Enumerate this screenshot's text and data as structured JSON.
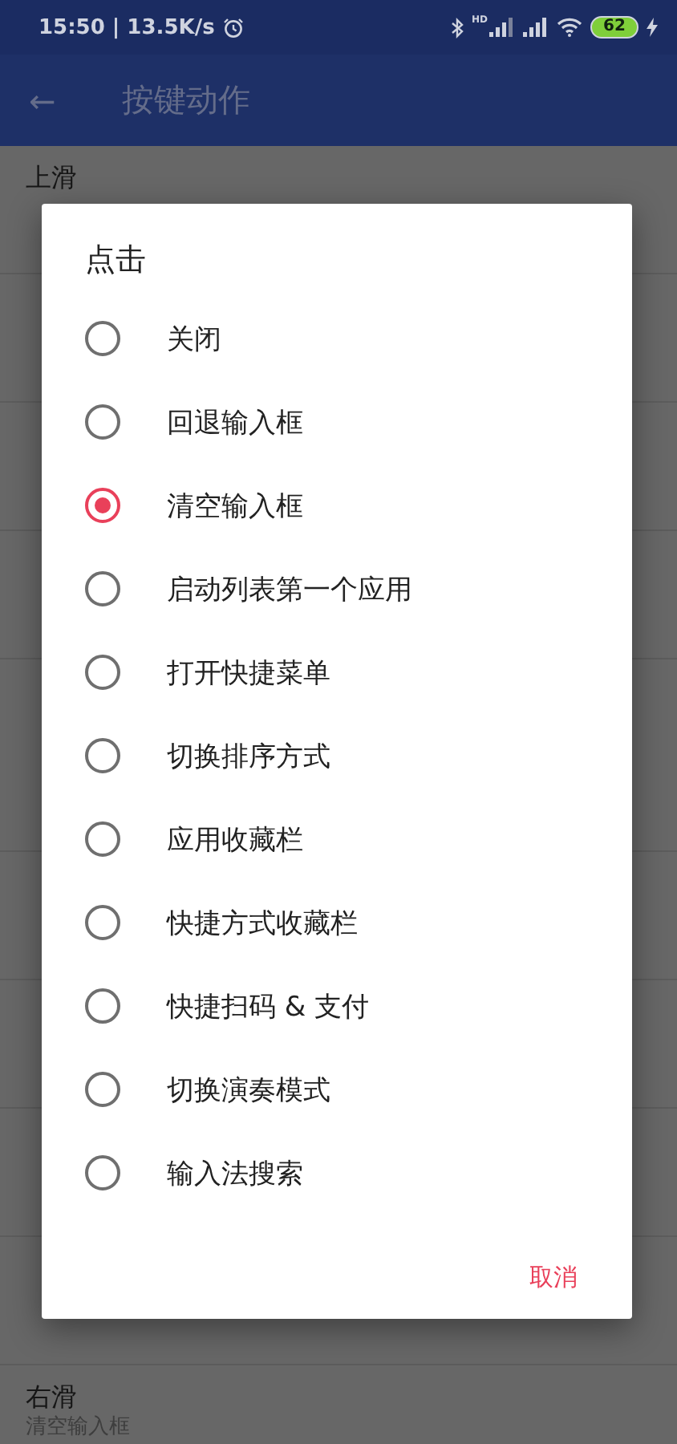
{
  "status_bar": {
    "time": "15:50 | 13.5K/s",
    "network_label": "HD",
    "battery": "62"
  },
  "app_bar": {
    "back": "←",
    "title": "按键动作"
  },
  "list": [
    {
      "kind": "row",
      "title": "上滑"
    },
    {
      "kind": "row"
    },
    {
      "kind": "row"
    },
    {
      "kind": "row"
    },
    {
      "kind": "header"
    },
    {
      "kind": "row"
    },
    {
      "kind": "row"
    },
    {
      "kind": "row"
    },
    {
      "kind": "row"
    },
    {
      "kind": "row"
    },
    {
      "kind": "row",
      "title": "右滑",
      "subtitle": "清空输入框"
    }
  ],
  "dialog": {
    "title": "点击",
    "options": [
      {
        "label": "关闭",
        "selected": false
      },
      {
        "label": "回退输入框",
        "selected": false
      },
      {
        "label": "清空输入框",
        "selected": true
      },
      {
        "label": "启动列表第一个应用",
        "selected": false
      },
      {
        "label": "打开快捷菜单",
        "selected": false
      },
      {
        "label": "切换排序方式",
        "selected": false
      },
      {
        "label": "应用收藏栏",
        "selected": false
      },
      {
        "label": "快捷方式收藏栏",
        "selected": false
      },
      {
        "label": "快捷扫码 & 支付",
        "selected": false
      },
      {
        "label": "切换演奏模式",
        "selected": false
      },
      {
        "label": "输入法搜索",
        "selected": false
      }
    ],
    "cancel": "取消"
  }
}
